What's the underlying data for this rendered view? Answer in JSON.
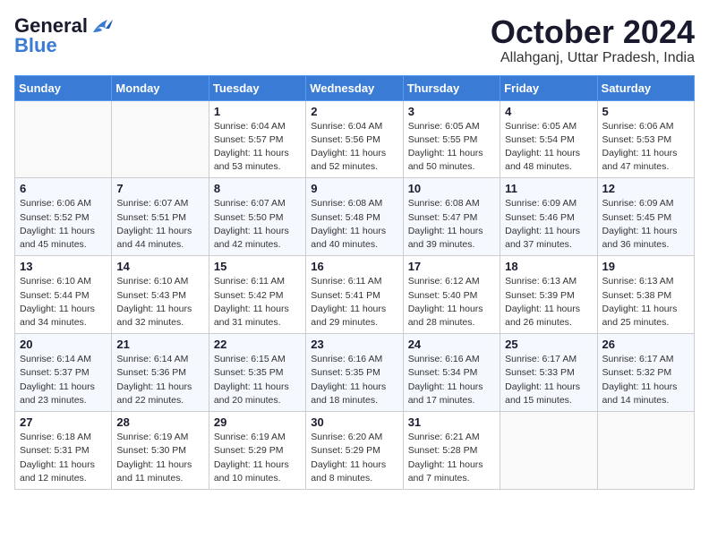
{
  "logo": {
    "general": "General",
    "blue": "Blue",
    "tagline": ""
  },
  "title": "October 2024",
  "location": "Allahganj, Uttar Pradesh, India",
  "weekdays": [
    "Sunday",
    "Monday",
    "Tuesday",
    "Wednesday",
    "Thursday",
    "Friday",
    "Saturday"
  ],
  "weeks": [
    [
      {
        "day": "",
        "info": ""
      },
      {
        "day": "",
        "info": ""
      },
      {
        "day": "1",
        "info": "Sunrise: 6:04 AM\nSunset: 5:57 PM\nDaylight: 11 hours and 53 minutes."
      },
      {
        "day": "2",
        "info": "Sunrise: 6:04 AM\nSunset: 5:56 PM\nDaylight: 11 hours and 52 minutes."
      },
      {
        "day": "3",
        "info": "Sunrise: 6:05 AM\nSunset: 5:55 PM\nDaylight: 11 hours and 50 minutes."
      },
      {
        "day": "4",
        "info": "Sunrise: 6:05 AM\nSunset: 5:54 PM\nDaylight: 11 hours and 48 minutes."
      },
      {
        "day": "5",
        "info": "Sunrise: 6:06 AM\nSunset: 5:53 PM\nDaylight: 11 hours and 47 minutes."
      }
    ],
    [
      {
        "day": "6",
        "info": "Sunrise: 6:06 AM\nSunset: 5:52 PM\nDaylight: 11 hours and 45 minutes."
      },
      {
        "day": "7",
        "info": "Sunrise: 6:07 AM\nSunset: 5:51 PM\nDaylight: 11 hours and 44 minutes."
      },
      {
        "day": "8",
        "info": "Sunrise: 6:07 AM\nSunset: 5:50 PM\nDaylight: 11 hours and 42 minutes."
      },
      {
        "day": "9",
        "info": "Sunrise: 6:08 AM\nSunset: 5:48 PM\nDaylight: 11 hours and 40 minutes."
      },
      {
        "day": "10",
        "info": "Sunrise: 6:08 AM\nSunset: 5:47 PM\nDaylight: 11 hours and 39 minutes."
      },
      {
        "day": "11",
        "info": "Sunrise: 6:09 AM\nSunset: 5:46 PM\nDaylight: 11 hours and 37 minutes."
      },
      {
        "day": "12",
        "info": "Sunrise: 6:09 AM\nSunset: 5:45 PM\nDaylight: 11 hours and 36 minutes."
      }
    ],
    [
      {
        "day": "13",
        "info": "Sunrise: 6:10 AM\nSunset: 5:44 PM\nDaylight: 11 hours and 34 minutes."
      },
      {
        "day": "14",
        "info": "Sunrise: 6:10 AM\nSunset: 5:43 PM\nDaylight: 11 hours and 32 minutes."
      },
      {
        "day": "15",
        "info": "Sunrise: 6:11 AM\nSunset: 5:42 PM\nDaylight: 11 hours and 31 minutes."
      },
      {
        "day": "16",
        "info": "Sunrise: 6:11 AM\nSunset: 5:41 PM\nDaylight: 11 hours and 29 minutes."
      },
      {
        "day": "17",
        "info": "Sunrise: 6:12 AM\nSunset: 5:40 PM\nDaylight: 11 hours and 28 minutes."
      },
      {
        "day": "18",
        "info": "Sunrise: 6:13 AM\nSunset: 5:39 PM\nDaylight: 11 hours and 26 minutes."
      },
      {
        "day": "19",
        "info": "Sunrise: 6:13 AM\nSunset: 5:38 PM\nDaylight: 11 hours and 25 minutes."
      }
    ],
    [
      {
        "day": "20",
        "info": "Sunrise: 6:14 AM\nSunset: 5:37 PM\nDaylight: 11 hours and 23 minutes."
      },
      {
        "day": "21",
        "info": "Sunrise: 6:14 AM\nSunset: 5:36 PM\nDaylight: 11 hours and 22 minutes."
      },
      {
        "day": "22",
        "info": "Sunrise: 6:15 AM\nSunset: 5:35 PM\nDaylight: 11 hours and 20 minutes."
      },
      {
        "day": "23",
        "info": "Sunrise: 6:16 AM\nSunset: 5:35 PM\nDaylight: 11 hours and 18 minutes."
      },
      {
        "day": "24",
        "info": "Sunrise: 6:16 AM\nSunset: 5:34 PM\nDaylight: 11 hours and 17 minutes."
      },
      {
        "day": "25",
        "info": "Sunrise: 6:17 AM\nSunset: 5:33 PM\nDaylight: 11 hours and 15 minutes."
      },
      {
        "day": "26",
        "info": "Sunrise: 6:17 AM\nSunset: 5:32 PM\nDaylight: 11 hours and 14 minutes."
      }
    ],
    [
      {
        "day": "27",
        "info": "Sunrise: 6:18 AM\nSunset: 5:31 PM\nDaylight: 11 hours and 12 minutes."
      },
      {
        "day": "28",
        "info": "Sunrise: 6:19 AM\nSunset: 5:30 PM\nDaylight: 11 hours and 11 minutes."
      },
      {
        "day": "29",
        "info": "Sunrise: 6:19 AM\nSunset: 5:29 PM\nDaylight: 11 hours and 10 minutes."
      },
      {
        "day": "30",
        "info": "Sunrise: 6:20 AM\nSunset: 5:29 PM\nDaylight: 11 hours and 8 minutes."
      },
      {
        "day": "31",
        "info": "Sunrise: 6:21 AM\nSunset: 5:28 PM\nDaylight: 11 hours and 7 minutes."
      },
      {
        "day": "",
        "info": ""
      },
      {
        "day": "",
        "info": ""
      }
    ]
  ]
}
